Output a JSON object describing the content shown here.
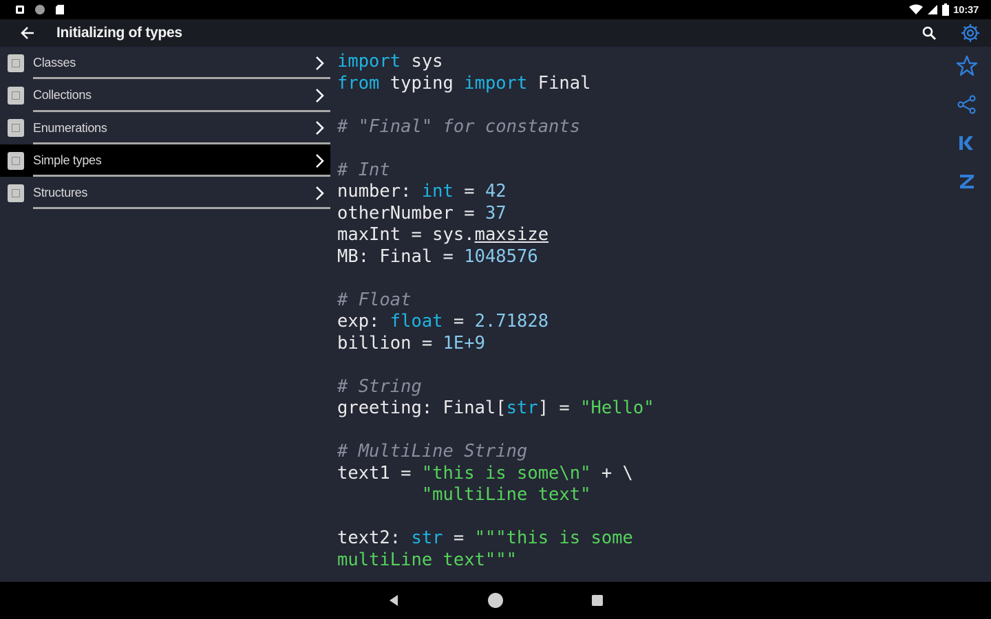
{
  "status_bar": {
    "time": "10:37",
    "icons": [
      "notification-icon",
      "circle-icon",
      "sd-card-icon",
      "wifi-icon",
      "signal-icon",
      "battery-icon"
    ]
  },
  "app_bar": {
    "title": "Initializing of types",
    "icons": [
      "back-arrow-icon",
      "search-icon",
      "settings-gear-icon"
    ]
  },
  "sidebar": {
    "items": [
      {
        "label": "Classes",
        "selected": false
      },
      {
        "label": "Collections",
        "selected": false
      },
      {
        "label": "Enumerations",
        "selected": false
      },
      {
        "label": "Simple types",
        "selected": true
      },
      {
        "label": "Structures",
        "selected": false
      }
    ]
  },
  "code": {
    "lines": [
      [
        {
          "t": "import",
          "c": "kw"
        },
        {
          "t": " sys",
          "c": ""
        }
      ],
      [
        {
          "t": "from",
          "c": "kw"
        },
        {
          "t": " typing ",
          "c": ""
        },
        {
          "t": "import",
          "c": "kw"
        },
        {
          "t": " Final",
          "c": ""
        }
      ],
      [],
      [
        {
          "t": "# \"Final\" for constants",
          "c": "cm"
        }
      ],
      [],
      [
        {
          "t": "# Int",
          "c": "cm"
        }
      ],
      [
        {
          "t": "number: ",
          "c": ""
        },
        {
          "t": "int",
          "c": "ty"
        },
        {
          "t": " = ",
          "c": ""
        },
        {
          "t": "42",
          "c": "num"
        }
      ],
      [
        {
          "t": "otherNumber = ",
          "c": ""
        },
        {
          "t": "37",
          "c": "num"
        }
      ],
      [
        {
          "t": "maxInt = sys.",
          "c": ""
        },
        {
          "t": "maxsize",
          "c": "ul"
        }
      ],
      [
        {
          "t": "MB: Final = ",
          "c": ""
        },
        {
          "t": "1048576",
          "c": "num"
        }
      ],
      [],
      [
        {
          "t": "# Float",
          "c": "cm"
        }
      ],
      [
        {
          "t": "exp: ",
          "c": ""
        },
        {
          "t": "float",
          "c": "ty"
        },
        {
          "t": " = ",
          "c": ""
        },
        {
          "t": "2.71828",
          "c": "num"
        }
      ],
      [
        {
          "t": "billion = ",
          "c": ""
        },
        {
          "t": "1E+9",
          "c": "num"
        }
      ],
      [],
      [
        {
          "t": "# String",
          "c": "cm"
        }
      ],
      [
        {
          "t": "greeting: Final[",
          "c": ""
        },
        {
          "t": "str",
          "c": "ty"
        },
        {
          "t": "] = ",
          "c": ""
        },
        {
          "t": "\"Hello\"",
          "c": "str"
        }
      ],
      [],
      [
        {
          "t": "# MultiLine String",
          "c": "cm"
        }
      ],
      [
        {
          "t": "text1 = ",
          "c": ""
        },
        {
          "t": "\"this is some\\n\"",
          "c": "str"
        },
        {
          "t": " + \\",
          "c": ""
        }
      ],
      [
        {
          "t": "        ",
          "c": ""
        },
        {
          "t": "\"multiLine text\"",
          "c": "str"
        }
      ],
      [],
      [
        {
          "t": "text2: ",
          "c": ""
        },
        {
          "t": "str",
          "c": "ty"
        },
        {
          "t": " = ",
          "c": ""
        },
        {
          "t": "\"\"\"this is some",
          "c": "str"
        }
      ],
      [
        {
          "t": "multiLine text\"\"\"",
          "c": "str"
        }
      ]
    ]
  },
  "right_rail": {
    "icons": [
      "favorite-star-icon",
      "share-icon",
      "first-item-icon",
      "last-item-icon"
    ]
  },
  "nav_bar": {
    "icons": [
      "back-triangle-icon",
      "home-circle-icon",
      "recents-square-icon"
    ]
  },
  "colors": {
    "background": "#242734",
    "app_bar": "#1a1c23",
    "accent": "#2f7fd8",
    "keyword": "#1fb4e0",
    "number": "#86c9ec",
    "string": "#55d25b",
    "comment": "#8a8e9e"
  }
}
